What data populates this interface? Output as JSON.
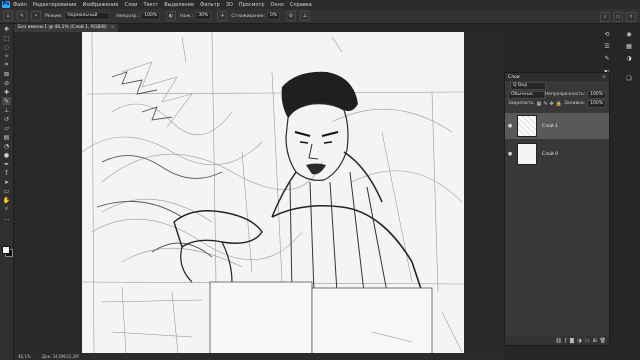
{
  "menu": {
    "items": [
      "Файл",
      "Редактирование",
      "Изображение",
      "Слои",
      "Текст",
      "Выделение",
      "Фильтр",
      "3D",
      "Просмотр",
      "Окно",
      "Справка"
    ]
  },
  "options": {
    "mode_label": "Режим:",
    "mode_value": "Нормальный",
    "opacity_label": "Непрозр.:",
    "opacity_value": "100%",
    "flow_label": "Наж.:",
    "flow_value": "30%",
    "smoothing_label": "Сглаживание:",
    "smoothing_value": "0%"
  },
  "document": {
    "tab_title": "Без имени-1 @ 46,1% (Слой 1, RGB/8)",
    "close_glyph": "×"
  },
  "status": {
    "zoom": "46,1%",
    "doc_info": "Док: 34,0М/22,2М"
  },
  "layers_panel": {
    "title": "Слои",
    "filter_label": "Q Вид",
    "blend_value": "Обычные",
    "opacity_label": "Непрозрачность:",
    "opacity_value": "100%",
    "lock_label": "Закрепить:",
    "fill_label": "Заливка:",
    "fill_value": "100%",
    "layers": [
      {
        "name": "Слой 1",
        "selected": true
      },
      {
        "name": "Слой 0",
        "selected": false
      }
    ]
  },
  "icons": {
    "eye": "eye-icon",
    "brush": "brush-icon"
  }
}
